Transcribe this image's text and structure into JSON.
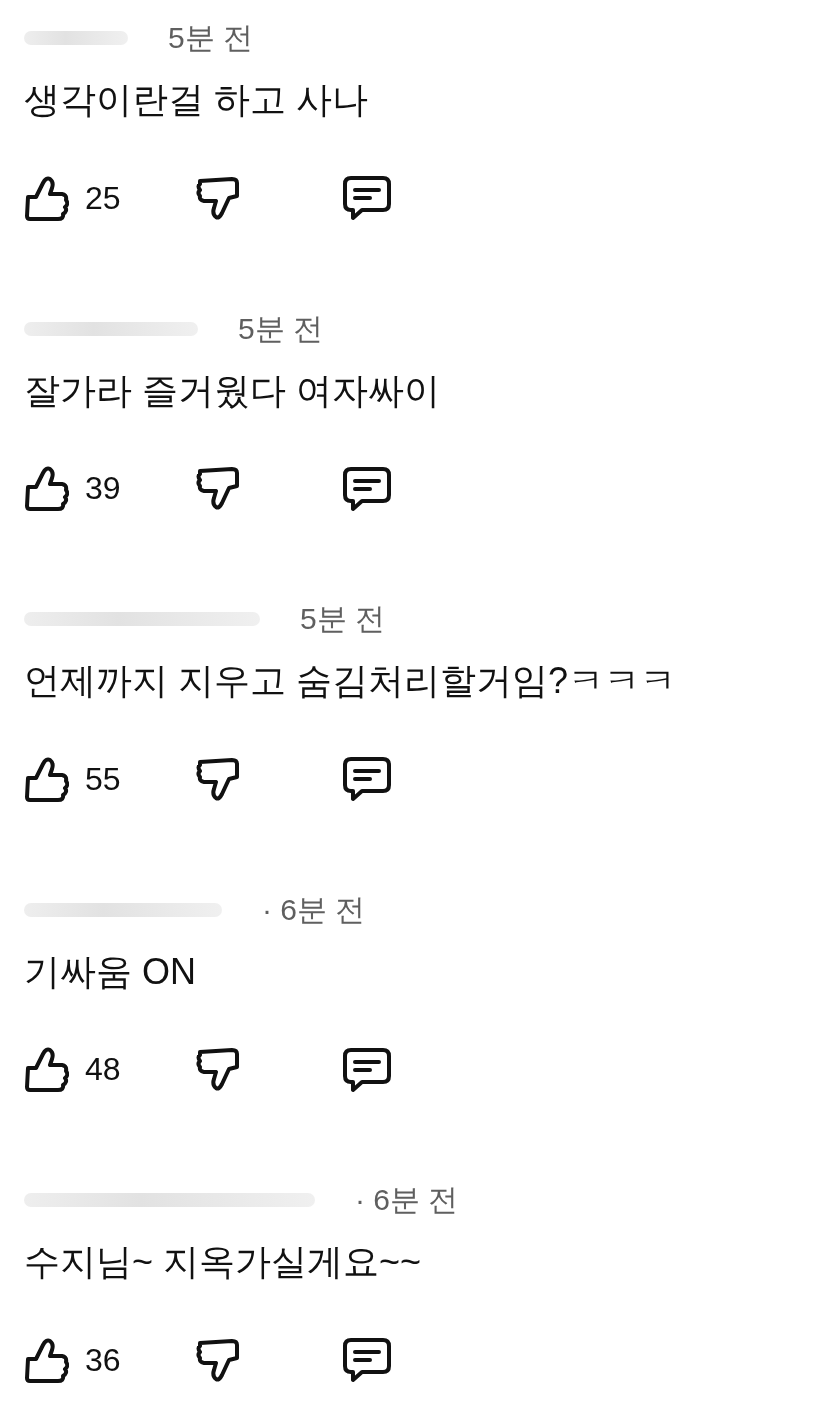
{
  "comments": [
    {
      "author": {
        "redacted": true
      },
      "time": "5분 전",
      "text": "생각이란걸 하고 사나",
      "likes": "25"
    },
    {
      "author": {
        "redacted": true
      },
      "time": "5분 전",
      "text": "잘가라 즐거웠다 여자싸이",
      "likes": "39"
    },
    {
      "author": {
        "redacted": true
      },
      "time": "5분 전",
      "text": "언제까지 지우고 숨김처리할거임?ㅋㅋㅋ",
      "likes": "55"
    },
    {
      "author": {
        "redacted": true
      },
      "time": "· 6분 전",
      "text": "기싸움 ON",
      "likes": "48"
    },
    {
      "author": {
        "redacted": true
      },
      "time": "· 6분 전",
      "text": "수지님~ 지옥가실게요~~",
      "likes": "36"
    }
  ]
}
